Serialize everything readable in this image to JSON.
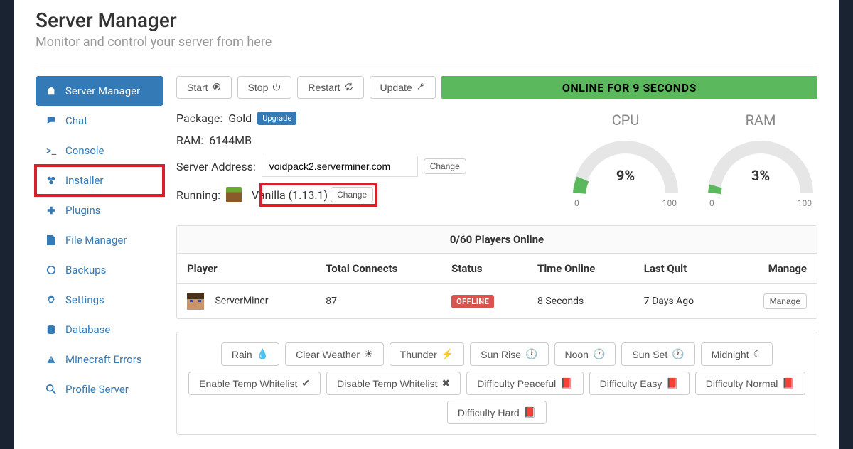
{
  "header": {
    "title": "Server Manager",
    "subtitle": "Monitor and control your server from here"
  },
  "sidebar": {
    "items": [
      {
        "label": "Server Manager",
        "icon": "home-icon"
      },
      {
        "label": "Chat",
        "icon": "chat-icon"
      },
      {
        "label": "Console",
        "icon": "console-icon"
      },
      {
        "label": "Installer",
        "icon": "installer-icon"
      },
      {
        "label": "Plugins",
        "icon": "plugin-icon"
      },
      {
        "label": "File Manager",
        "icon": "file-icon"
      },
      {
        "label": "Backups",
        "icon": "backup-icon"
      },
      {
        "label": "Settings",
        "icon": "gear-icon"
      },
      {
        "label": "Database",
        "icon": "database-icon"
      },
      {
        "label": "Minecraft Errors",
        "icon": "warning-icon"
      },
      {
        "label": "Profile Server",
        "icon": "search-icon"
      }
    ]
  },
  "toolbar": {
    "start": "Start",
    "stop": "Stop",
    "restart": "Restart",
    "update": "Update",
    "status": "ONLINE FOR 9 SECONDS"
  },
  "info": {
    "package_label": "Package:",
    "package_value": "Gold",
    "upgrade": "Upgrade",
    "ram_label": "RAM:",
    "ram_value": "6144MB",
    "address_label": "Server Address:",
    "address_value": "voidpack2.serverminer.com",
    "change": "Change",
    "running_label": "Running:",
    "running_value": "Vanilla (1.13.1)"
  },
  "gauges": {
    "cpu": {
      "title": "CPU",
      "value": "9%",
      "min": "0",
      "max": "100"
    },
    "ram": {
      "title": "RAM",
      "value": "3%",
      "min": "0",
      "max": "100"
    }
  },
  "players": {
    "header": "0/60 Players Online",
    "columns": {
      "player": "Player",
      "connects": "Total Connects",
      "status": "Status",
      "time": "Time Online",
      "lastquit": "Last Quit",
      "manage": "Manage"
    },
    "rows": [
      {
        "name": "ServerMiner",
        "connects": "87",
        "status": "OFFLINE",
        "time": "8 Seconds",
        "lastquit": "7 Days Ago",
        "manage": "Manage"
      }
    ]
  },
  "quick": {
    "rain": "Rain",
    "clear": "Clear Weather",
    "thunder": "Thunder",
    "sunrise": "Sun Rise",
    "noon": "Noon",
    "sunset": "Sun Set",
    "midnight": "Midnight",
    "enable_wl": "Enable Temp Whitelist",
    "disable_wl": "Disable Temp Whitelist",
    "diff_peace": "Difficulty Peaceful",
    "diff_easy": "Difficulty Easy",
    "diff_normal": "Difficulty Normal",
    "diff_hard": "Difficulty Hard"
  }
}
